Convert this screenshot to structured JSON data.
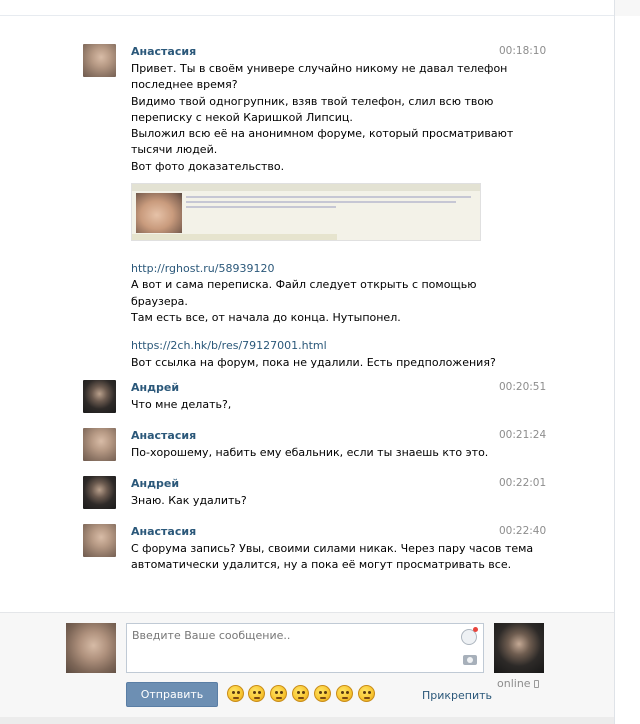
{
  "messages": [
    {
      "author": "Анастасия",
      "time": "00:18:10",
      "lines": [
        "Привет. Ты в своём универе случайно никому не давал телефон",
        "последнее время?",
        "Видимо твой одногрупник, взяв твой телефон, слил всю твою",
        "переписку с некой Каришкой Липсиц.",
        "Выложил всю её на анонимном форуме, который просматривают",
        "тысячи людей.",
        "Вот фото доказательство."
      ],
      "link1": "http://rghost.ru/58939120",
      "lines2": [
        "А вот и сама переписка. Файл следует открыть с помощью",
        "браузера.",
        "Там есть все, от начала до конца. Нутыпонел."
      ],
      "link2": "https://2ch.hk/b/res/79127001.html",
      "lines3": [
        "Вот ссылка на форум, пока не удалили. Есть предположения?"
      ]
    },
    {
      "author": "Андрей",
      "time": "00:20:51",
      "lines": [
        "Что мне делать?,"
      ]
    },
    {
      "author": "Анастасия",
      "time": "00:21:24",
      "lines": [
        "По-хорошему, набить ему ебальник, если ты знаешь кто это."
      ]
    },
    {
      "author": "Андрей",
      "time": "00:22:01",
      "lines": [
        "Знаю. Как удалить?"
      ]
    },
    {
      "author": "Анастасия",
      "time": "00:22:40",
      "lines": [
        "С форума запись? Увы, своими силами никак. Через пару часов тема",
        "автоматически удалится, ну а пока её могут просматривать все."
      ]
    }
  ],
  "composer": {
    "placeholder": "Введите Ваше сообщение..",
    "send_label": "Отправить",
    "attach_label": "Прикрепить",
    "status": "online"
  },
  "icons": {
    "emoji_picker": "smile-icon",
    "camera": "camera-icon",
    "mobile": "phone-icon"
  }
}
